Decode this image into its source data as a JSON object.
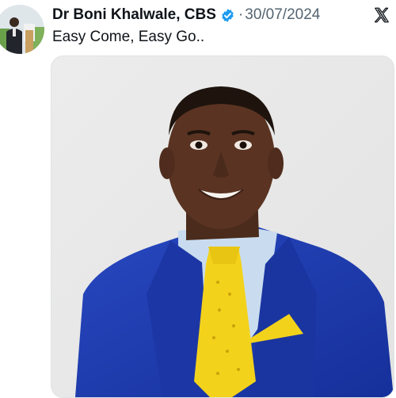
{
  "tweet": {
    "author_name": "Dr Boni Khalwale, CBS",
    "separator": "·",
    "date": "30/07/2024",
    "text": "Easy Come, Easy Go.."
  },
  "icons": {
    "verified": "verified-badge-icon",
    "platform": "x-logo-icon"
  },
  "colors": {
    "verified_blue": "#1d9bf0",
    "text_primary": "#0f1419",
    "text_secondary": "#536471",
    "suit_blue": "#1f3fae",
    "tie_yellow": "#f3d21b"
  }
}
